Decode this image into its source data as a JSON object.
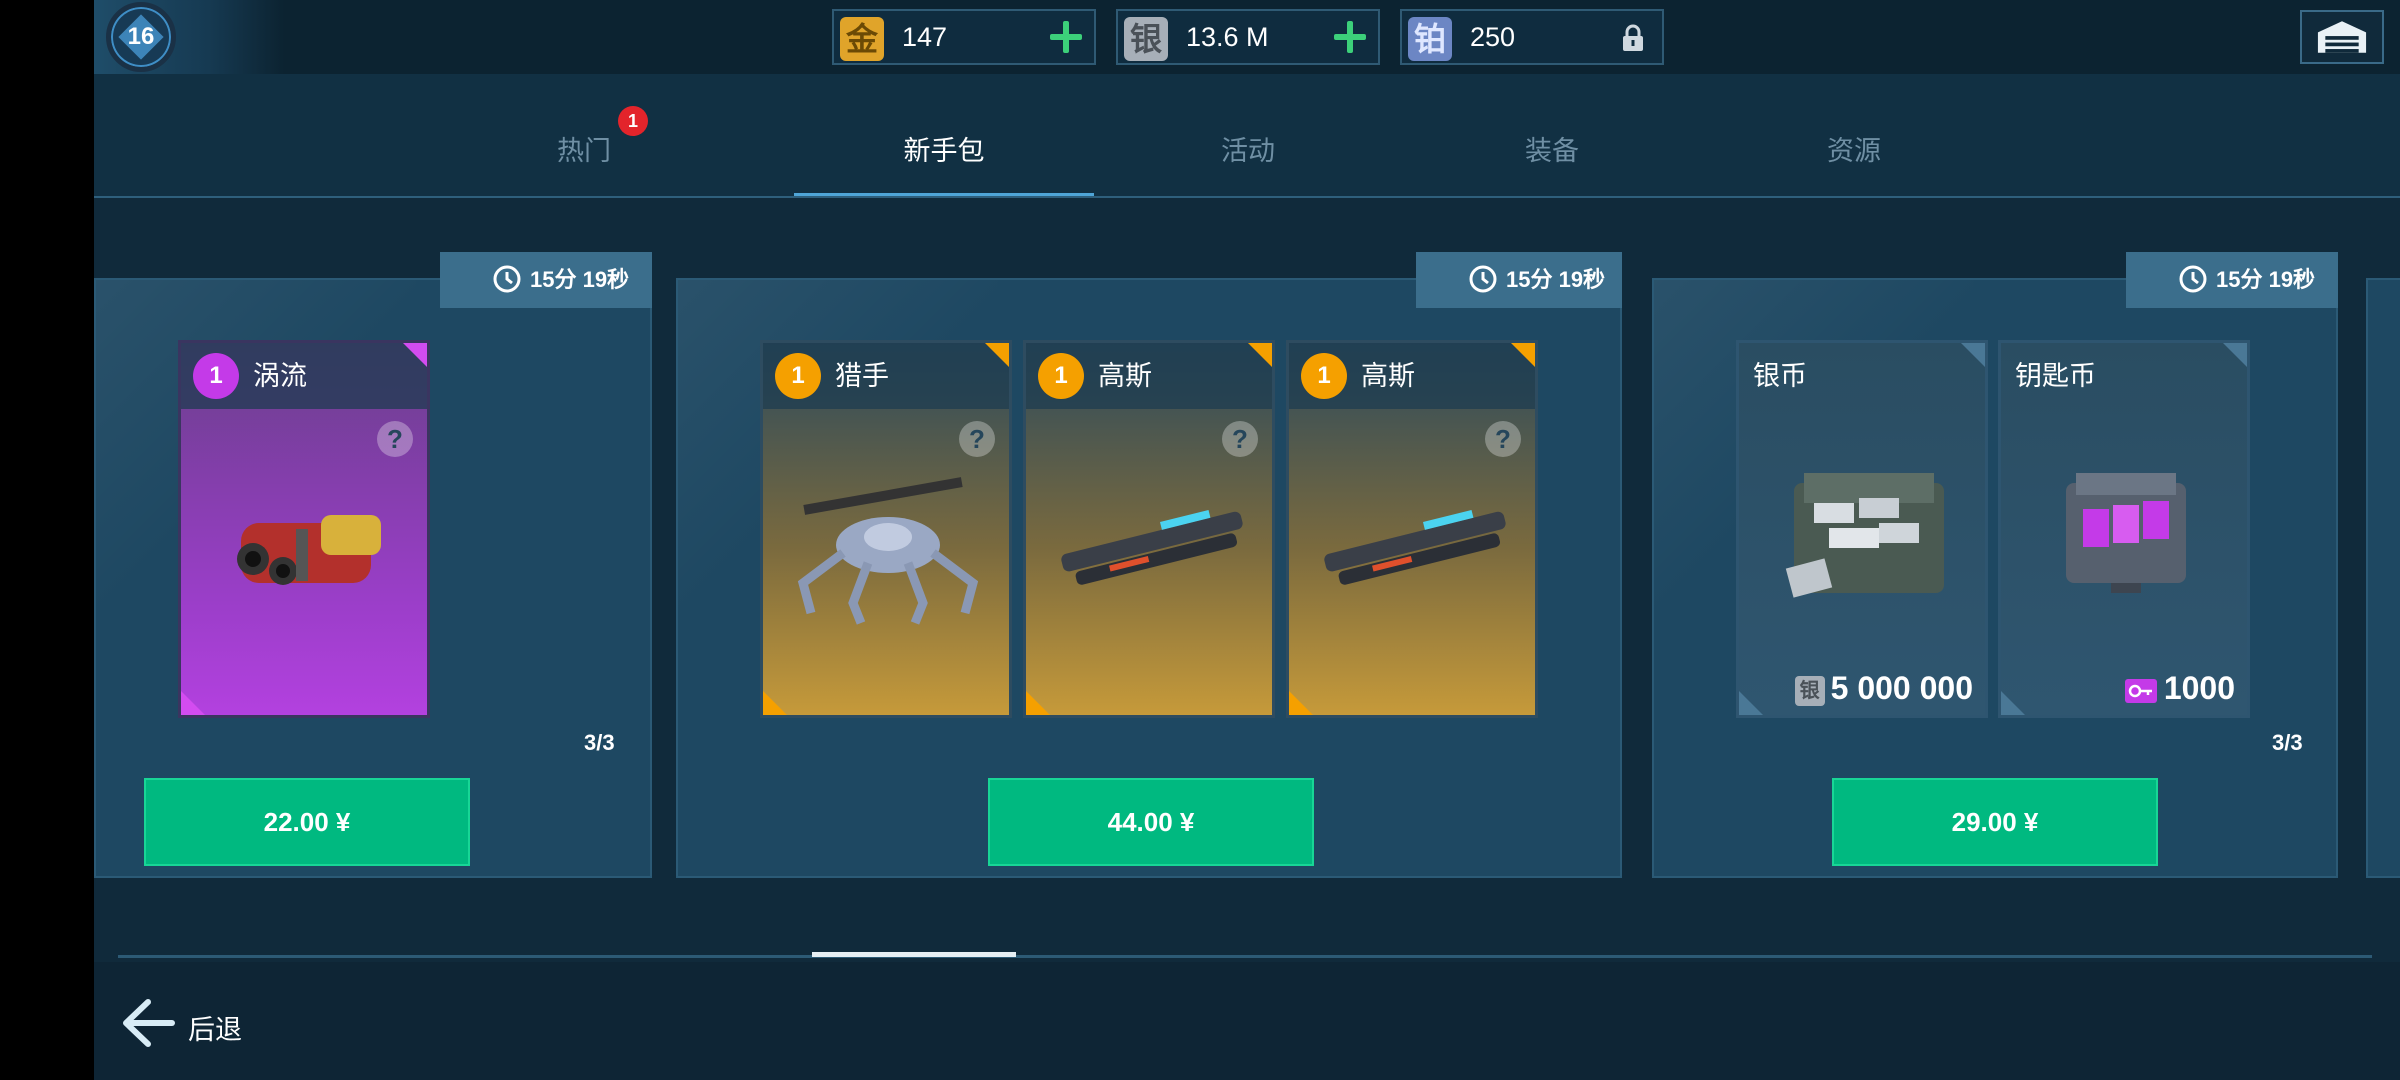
{
  "player": {
    "level": "16"
  },
  "currencies": [
    {
      "badge": "金",
      "value": "147",
      "color": "#e0a42a",
      "action": "plus-icon"
    },
    {
      "badge": "银",
      "value": "13.6 M",
      "color": "#a7afb8",
      "action": "plus-icon"
    },
    {
      "badge": "铂",
      "value": "250",
      "color": "#6c86c4",
      "action": "lock-icon"
    }
  ],
  "tabs": [
    {
      "label": "热门",
      "badge": "1"
    },
    {
      "label": "新手包",
      "active": true
    },
    {
      "label": "活动"
    },
    {
      "label": "装备"
    },
    {
      "label": "资源"
    }
  ],
  "offers": [
    {
      "timer": "15分 19秒",
      "count": "3/3",
      "price": "22.00 ¥",
      "items": [
        {
          "name": "涡流",
          "level": "1",
          "rarity": "epic",
          "icon": "vortex-weapon-icon",
          "help": "?"
        }
      ]
    },
    {
      "timer": "15分 19秒",
      "price": "44.00 ¥",
      "items": [
        {
          "name": "猎手",
          "level": "1",
          "rarity": "legendary",
          "icon": "hunter-robot-icon",
          "help": "?"
        },
        {
          "name": "高斯",
          "level": "1",
          "rarity": "legendary",
          "icon": "gauss-weapon-icon",
          "help": "?"
        },
        {
          "name": "高斯",
          "level": "1",
          "rarity": "legendary",
          "icon": "gauss-weapon-icon",
          "help": "?"
        }
      ]
    },
    {
      "timer": "15分 19秒",
      "count": "3/3",
      "price": "29.00 ¥",
      "items": [
        {
          "name": "银币",
          "icon": "silver-chest-icon",
          "amount_badge": "银",
          "amount": "5 000 000"
        },
        {
          "name": "钥匙币",
          "icon": "key-chest-icon",
          "amount_icon": "key-icon",
          "amount": "1000"
        }
      ]
    }
  ],
  "colors": {
    "epic": "#b236e3",
    "legendary": "#f5a000",
    "buy": "#00b980"
  },
  "back_label": "后退"
}
